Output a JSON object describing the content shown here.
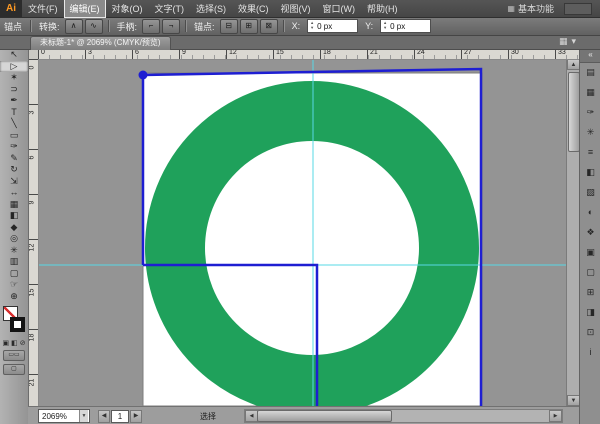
{
  "colors": {
    "ring_green": "#1fa15b",
    "selection_blue": "#1e1ed2",
    "guide_cyan": "#57d8e6"
  },
  "menu_bar": {
    "logo": "Ai",
    "items": [
      {
        "label": "文件(F)",
        "hl": false
      },
      {
        "label": "编辑(E)",
        "hl": true
      },
      {
        "label": "对象(O)",
        "hl": false
      },
      {
        "label": "文字(T)",
        "hl": false
      },
      {
        "label": "选择(S)",
        "hl": false
      },
      {
        "label": "效果(C)",
        "hl": false
      },
      {
        "label": "视图(V)",
        "hl": false
      },
      {
        "label": "窗口(W)",
        "hl": false
      },
      {
        "label": "帮助(H)",
        "hl": false
      }
    ],
    "workspace": "基本功能"
  },
  "control_bar": {
    "context_label": "锚点",
    "convert_label": "转换:",
    "convert_buttons": [
      {
        "name": "convert-to-corner-button",
        "glyph": "∧"
      },
      {
        "name": "convert-to-smooth-button",
        "glyph": "∿"
      }
    ],
    "handles_label": "手柄:",
    "handle_buttons": [
      {
        "name": "show-handles-button",
        "glyph": "⌐"
      },
      {
        "name": "hide-handles-button",
        "glyph": "¬"
      }
    ],
    "anchors_label": "锚点:",
    "anchor_buttons": [
      {
        "name": "remove-anchor-button",
        "glyph": "⊟"
      },
      {
        "name": "add-anchor-button",
        "glyph": "⊞"
      },
      {
        "name": "cut-path-button",
        "glyph": "⊠"
      }
    ],
    "x_label": "X:",
    "x_value": "0 px",
    "y_label": "Y:",
    "y_value": "0 px"
  },
  "tab_bar": {
    "document_title": "未标题-1* @ 2069% (CMYK/预览)"
  },
  "rulers": {
    "horizontal": [
      "0",
      "3",
      "6",
      "9",
      "12",
      "15",
      "18",
      "21",
      "24",
      "27",
      "30",
      "33"
    ],
    "vertical": [
      "0",
      "3",
      "6",
      "9",
      "12",
      "15",
      "18",
      "21"
    ]
  },
  "toolbar": {
    "tools": [
      {
        "name": "selection-tool",
        "glyph": "↖",
        "active": false
      },
      {
        "name": "direct-selection-tool",
        "glyph": "▷",
        "active": true
      },
      {
        "name": "magic-wand-tool",
        "glyph": "✶",
        "active": false
      },
      {
        "name": "lasso-tool",
        "glyph": "⊃",
        "active": false
      },
      {
        "name": "pen-tool",
        "glyph": "✒",
        "active": false
      },
      {
        "name": "type-tool",
        "glyph": "T",
        "active": false
      },
      {
        "name": "line-segment-tool",
        "glyph": "╲",
        "active": false
      },
      {
        "name": "rectangle-tool",
        "glyph": "▭",
        "active": false
      },
      {
        "name": "paintbrush-tool",
        "glyph": "✑",
        "active": false
      },
      {
        "name": "pencil-tool",
        "glyph": "✎",
        "active": false
      },
      {
        "name": "rotate-tool",
        "glyph": "↻",
        "active": false
      },
      {
        "name": "scale-tool",
        "glyph": "⇲",
        "active": false
      },
      {
        "name": "width-tool",
        "glyph": "↔",
        "active": false
      },
      {
        "name": "mesh-tool",
        "glyph": "▦",
        "active": false
      },
      {
        "name": "gradient-tool",
        "glyph": "◧",
        "active": false
      },
      {
        "name": "eyedropper-tool",
        "glyph": "◆",
        "active": false
      },
      {
        "name": "blend-tool",
        "glyph": "◎",
        "active": false
      },
      {
        "name": "symbol-sprayer-tool",
        "glyph": "✳",
        "active": false
      },
      {
        "name": "column-graph-tool",
        "glyph": "▥",
        "active": false
      },
      {
        "name": "artboard-tool",
        "glyph": "▢",
        "active": false
      },
      {
        "name": "hand-tool",
        "glyph": "☞",
        "active": false
      },
      {
        "name": "zoom-tool",
        "glyph": "⊕",
        "active": false
      }
    ]
  },
  "panel_strip": {
    "collapse_glyph": "«",
    "icons": [
      {
        "name": "color-panel-icon",
        "glyph": "▤"
      },
      {
        "name": "swatches-panel-icon",
        "glyph": "▦"
      },
      {
        "name": "brushes-panel-icon",
        "glyph": "✑"
      },
      {
        "name": "symbols-panel-icon",
        "glyph": "✳"
      },
      {
        "name": "stroke-panel-icon",
        "glyph": "≡"
      },
      {
        "name": "gradient-panel-icon",
        "glyph": "◧"
      },
      {
        "name": "transparency-panel-icon",
        "glyph": "▨"
      },
      {
        "name": "appearance-panel-icon",
        "glyph": "◐"
      },
      {
        "name": "graphic-styles-panel-icon",
        "glyph": "❖"
      },
      {
        "name": "layers-panel-icon",
        "glyph": "▣"
      },
      {
        "name": "artboards-panel-icon",
        "glyph": "▢"
      },
      {
        "name": "align-panel-icon",
        "glyph": "⊞"
      },
      {
        "name": "pathfinder-panel-icon",
        "glyph": "◨"
      },
      {
        "name": "navigator-panel-icon",
        "glyph": "⊡"
      },
      {
        "name": "info-panel-icon",
        "glyph": "i"
      }
    ]
  },
  "status_bar": {
    "zoom": "2069%",
    "artboard_number": "1",
    "status_text": "选择"
  }
}
